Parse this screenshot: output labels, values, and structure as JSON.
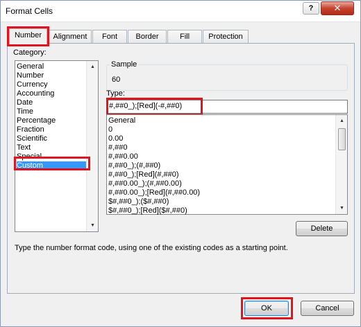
{
  "window": {
    "title": "Format Cells",
    "help_glyph": "?",
    "close_glyph": "✕"
  },
  "tabs": [
    {
      "label": "Number"
    },
    {
      "label": "Alignment"
    },
    {
      "label": "Font"
    },
    {
      "label": "Border"
    },
    {
      "label": "Fill"
    },
    {
      "label": "Protection"
    }
  ],
  "category": {
    "label": "Category:",
    "items": [
      "General",
      "Number",
      "Currency",
      "Accounting",
      "Date",
      "Time",
      "Percentage",
      "Fraction",
      "Scientific",
      "Text",
      "Special",
      "Custom"
    ],
    "selected": "Custom"
  },
  "sample": {
    "label": "Sample",
    "value": "60"
  },
  "type": {
    "label": "Type:",
    "value": "#,##0_);[Red](-#,##0)"
  },
  "formats": [
    "General",
    "0",
    "0.00",
    "#,##0",
    "#,##0.00",
    "#,##0_);(#,##0)",
    "#,##0_);[Red](#,##0)",
    "#,##0.00_);(#,##0.00)",
    "#,##0.00_);[Red](#,##0.00)",
    "$#,##0_);($#,##0)",
    "$#,##0_);[Red]($#,##0)"
  ],
  "buttons": {
    "delete": "Delete",
    "ok": "OK",
    "cancel": "Cancel"
  },
  "hint": "Type the number format code, using one of the existing codes as a starting point.",
  "colors": {
    "highlight": "#e0141e",
    "selection": "#3399ff"
  }
}
